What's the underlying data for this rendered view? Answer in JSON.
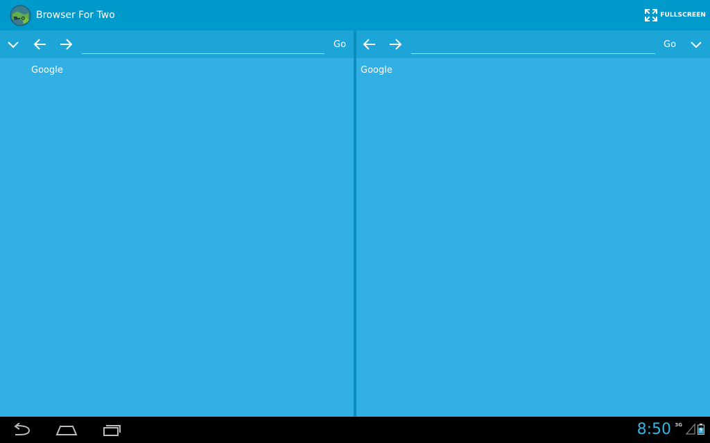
{
  "app": {
    "title": "Browser For Two",
    "icon": "app-logo-icon",
    "fullscreen_label": "FULLSCREEN"
  },
  "left_pane": {
    "url_value": "",
    "url_placeholder": "",
    "go_label": "Go",
    "bookmark": "Google"
  },
  "right_pane": {
    "url_value": "",
    "url_placeholder": "",
    "go_label": "Go",
    "bookmark": "Google"
  },
  "system_bar": {
    "clock": "8:50",
    "network": "3G"
  },
  "colors": {
    "titlebar": "#0099cc",
    "toolbar": "#1ea5d8",
    "content": "#33b0e3",
    "divider": "#0a8fc0",
    "clock": "#33b5e5"
  }
}
